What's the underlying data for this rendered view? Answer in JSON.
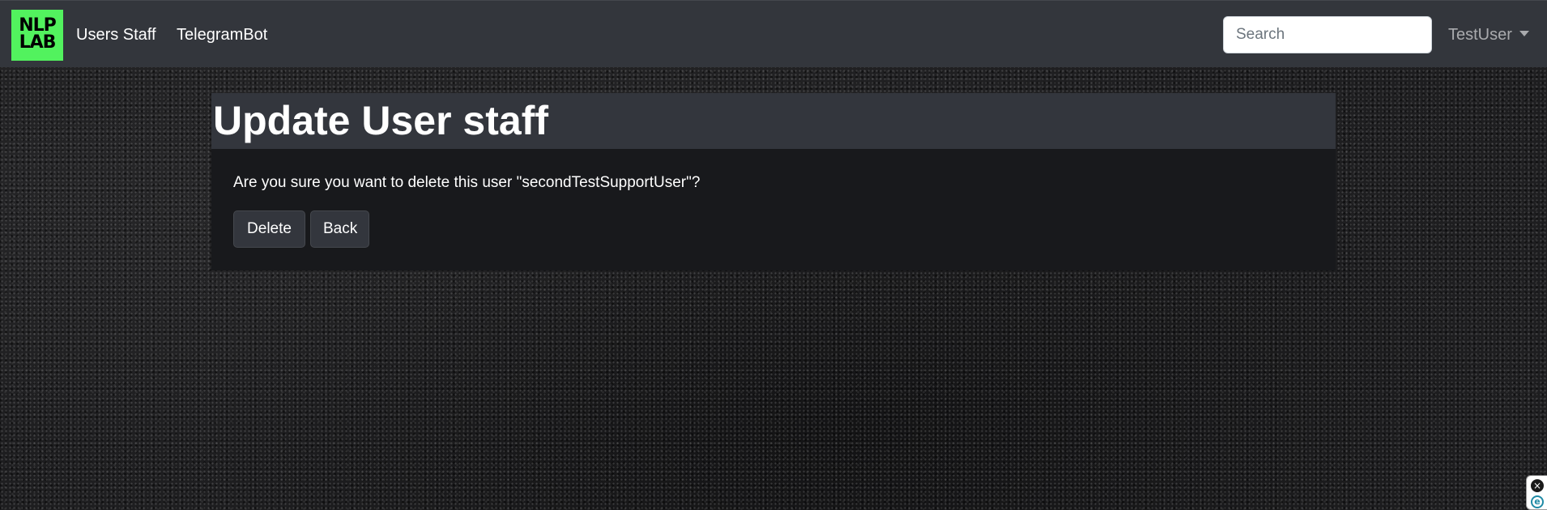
{
  "navbar": {
    "logo_top": "NLP",
    "logo_bottom": "LAB",
    "links": [
      {
        "label": "Users Staff"
      },
      {
        "label": "TelegramBot"
      }
    ],
    "search": {
      "placeholder": "Search",
      "value": ""
    },
    "user": {
      "name": "TestUser"
    }
  },
  "card": {
    "title": "Update User staff",
    "message": "Are you sure you want to delete this user \"secondTestSupportUser\"?",
    "buttons": {
      "delete_label": "Delete",
      "back_label": "Back"
    }
  },
  "widget": {
    "close_icon": "×",
    "logo_letter": "e"
  },
  "colors": {
    "navbar_bg": "#33363c",
    "logo_bg": "#52f25e",
    "card_header_bg": "#33363d",
    "card_body_bg": "#18191c",
    "button_bg": "#33363d"
  }
}
